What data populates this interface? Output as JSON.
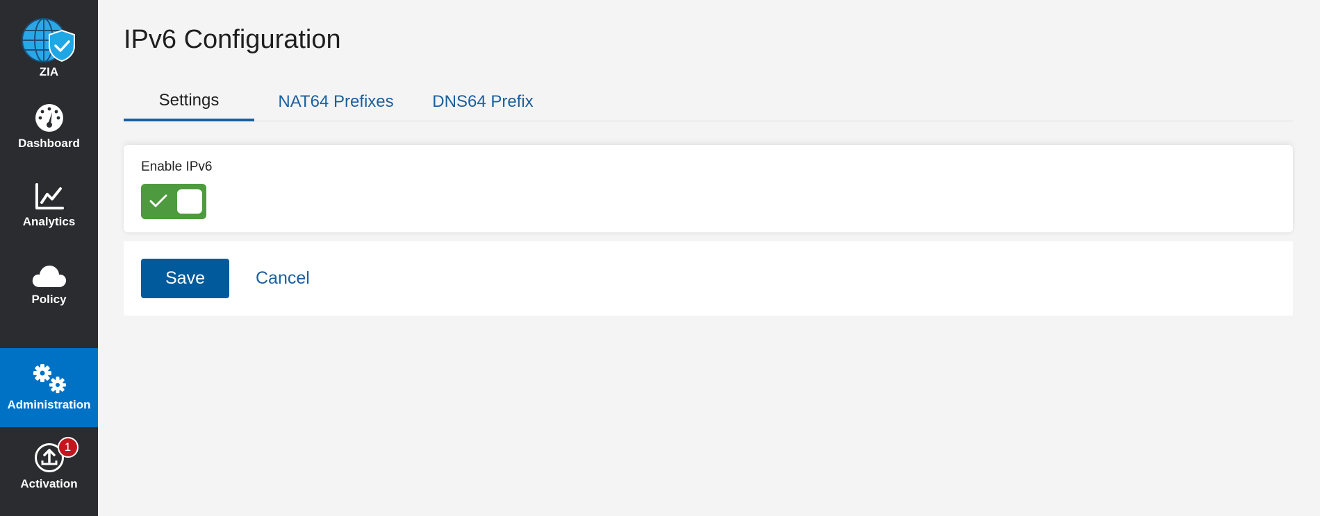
{
  "sidebar": {
    "items": [
      {
        "label": "ZIA",
        "icon": "zia-globe-shield-icon"
      },
      {
        "label": "Dashboard",
        "icon": "dashboard-gauge-icon"
      },
      {
        "label": "Analytics",
        "icon": "line-chart-icon"
      },
      {
        "label": "Policy",
        "icon": "cloud-icon"
      },
      {
        "label": "Administration",
        "icon": "gears-icon",
        "active": true
      },
      {
        "label": "Activation",
        "icon": "upload-activation-icon",
        "badge": "1"
      }
    ]
  },
  "page": {
    "title": "IPv6 Configuration"
  },
  "tabs": [
    {
      "label": "Settings",
      "active": true
    },
    {
      "label": "NAT64 Prefixes"
    },
    {
      "label": "DNS64 Prefix"
    }
  ],
  "settings": {
    "enable_ipv6_label": "Enable IPv6",
    "enable_ipv6_value": true
  },
  "actions": {
    "save_label": "Save",
    "cancel_label": "Cancel"
  },
  "colors": {
    "sidebar_bg": "#2a2c30",
    "active_nav": "#0072c6",
    "toggle_on": "#4e9a3e",
    "primary_button": "#005a9c",
    "link": "#1a5f9e",
    "badge": "#c4161c"
  }
}
